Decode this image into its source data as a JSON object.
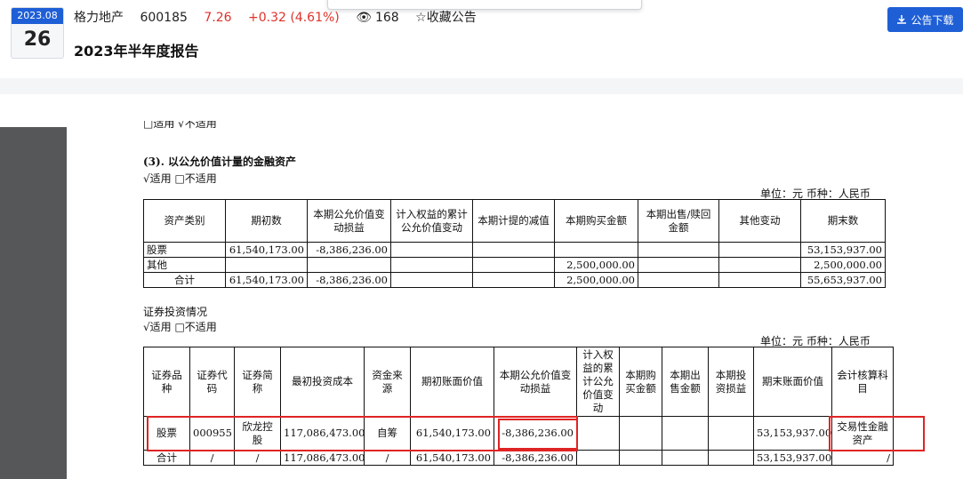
{
  "header": {
    "date_month": "2023.08",
    "date_day": "26",
    "company": "格力地产",
    "code": "600185",
    "price": "7.26",
    "change": "+0.32 (4.61%)",
    "views": "168",
    "favorite": "收藏公告",
    "title": "2023年半年度报告",
    "download": "公告下载"
  },
  "doc": {
    "cut_line": "□适用 √不适用",
    "section3_title": "(3). 以公允价值计量的金融资产",
    "section3_applicable": "√适用   □不适用",
    "unit_line": "单位：元    币种：人民币",
    "table1": {
      "headers": [
        "资产类别",
        "期初数",
        "本期公允价值变动损益",
        "计入权益的累计公允价值变动",
        "本期计提的减值",
        "本期购买金额",
        "本期出售/赎回金额",
        "其他变动",
        "期末数"
      ],
      "rows": [
        [
          "股票",
          "61,540,173.00",
          "-8,386,236.00",
          "",
          "",
          "",
          "",
          "",
          "53,153,937.00"
        ],
        [
          "其他",
          "",
          "",
          "",
          "",
          "2,500,000.00",
          "",
          "",
          "2,500,000.00"
        ],
        [
          "合计",
          "61,540,173.00",
          "-8,386,236.00",
          "",
          "",
          "2,500,000.00",
          "",
          "",
          "55,653,937.00"
        ]
      ]
    },
    "section2_title": "证券投资情况",
    "section2_applicable": "√适用   □不适用",
    "table2": {
      "headers": [
        "证券品种",
        "证券代码",
        "证券简称",
        "最初投资成本",
        "资金来源",
        "期初账面价值",
        "本期公允价值变动损益",
        "计入权益的累计公允价值变动",
        "本期购买金额",
        "本期出售金额",
        "本期投资损益",
        "期末账面价值",
        "会计核算科目"
      ],
      "rows": [
        [
          "股票",
          "000955",
          "欣龙控股",
          "117,086,473.00",
          "自筹",
          "61,540,173.00",
          "-8,386,236.00",
          "",
          "",
          "",
          "",
          "53,153,937.00",
          "交易性金融资产"
        ],
        [
          "合计",
          "/",
          "/",
          "117,086,473.00",
          "/",
          "61,540,173.00",
          "-8,386,236.00",
          "",
          "",
          "",
          "",
          "53,153,937.00",
          "/"
        ]
      ]
    }
  }
}
